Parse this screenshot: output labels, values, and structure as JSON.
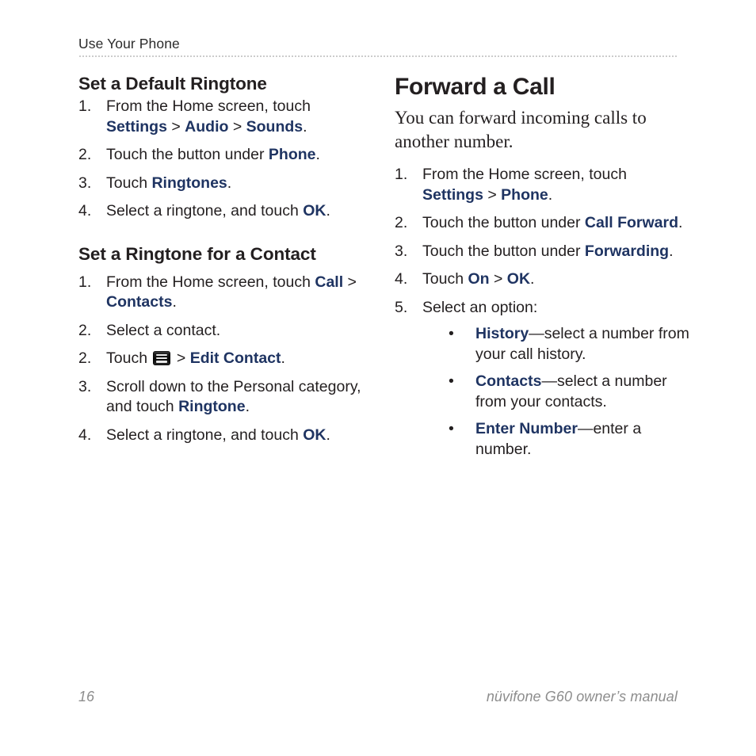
{
  "header": {
    "running_head": "Use Your Phone"
  },
  "left_column": {
    "sections": [
      {
        "heading": "Set a Default Ringtone",
        "steps": [
          {
            "num": "1.",
            "parts": [
              {
                "t": "From the Home screen, touch ",
                "s": "plain"
              },
              {
                "t": "Settings",
                "s": "ui"
              },
              {
                "t": " > ",
                "s": "plain"
              },
              {
                "t": "Audio",
                "s": "ui"
              },
              {
                "t": " > ",
                "s": "plain"
              },
              {
                "t": "Sounds",
                "s": "ui"
              },
              {
                "t": ".",
                "s": "plain"
              }
            ]
          },
          {
            "num": "2.",
            "parts": [
              {
                "t": "Touch the button under ",
                "s": "plain"
              },
              {
                "t": "Phone",
                "s": "ui"
              },
              {
                "t": ".",
                "s": "plain"
              }
            ]
          },
          {
            "num": "3.",
            "parts": [
              {
                "t": "Touch ",
                "s": "plain"
              },
              {
                "t": "Ringtones",
                "s": "ui"
              },
              {
                "t": ".",
                "s": "plain"
              }
            ]
          },
          {
            "num": "4.",
            "parts": [
              {
                "t": "Select a ringtone, and touch ",
                "s": "plain"
              },
              {
                "t": "OK",
                "s": "ui"
              },
              {
                "t": ".",
                "s": "plain"
              }
            ]
          }
        ]
      },
      {
        "heading": "Set a Ringtone for a Contact",
        "steps": [
          {
            "num": "1.",
            "parts": [
              {
                "t": "From the Home screen, touch ",
                "s": "plain"
              },
              {
                "t": "Call",
                "s": "ui"
              },
              {
                "t": " > ",
                "s": "plain"
              },
              {
                "t": "Contacts",
                "s": "ui"
              },
              {
                "t": ".",
                "s": "plain"
              }
            ]
          },
          {
            "num": "2.",
            "parts": [
              {
                "t": "Select a contact.",
                "s": "plain"
              }
            ]
          },
          {
            "num": "2.",
            "parts": [
              {
                "t": "Touch ",
                "s": "plain"
              },
              {
                "t": "menu-icon",
                "s": "icon"
              },
              {
                "t": " > ",
                "s": "plain"
              },
              {
                "t": "Edit Contact",
                "s": "ui"
              },
              {
                "t": ".",
                "s": "plain"
              }
            ]
          },
          {
            "num": "3.",
            "parts": [
              {
                "t": "Scroll down to the Personal category, and touch ",
                "s": "plain"
              },
              {
                "t": "Ringtone",
                "s": "ui"
              },
              {
                "t": ".",
                "s": "plain"
              }
            ]
          },
          {
            "num": "4.",
            "parts": [
              {
                "t": "Select a ringtone, and touch ",
                "s": "plain"
              },
              {
                "t": "OK",
                "s": "ui"
              },
              {
                "t": ".",
                "s": "plain"
              }
            ]
          }
        ]
      }
    ]
  },
  "right_column": {
    "heading": "Forward a Call",
    "intro": "You can forward incoming calls to another number.",
    "steps": [
      {
        "num": "1.",
        "parts": [
          {
            "t": "From the Home screen, touch ",
            "s": "plain"
          },
          {
            "t": "Settings",
            "s": "ui"
          },
          {
            "t": " > ",
            "s": "plain"
          },
          {
            "t": "Phone",
            "s": "ui"
          },
          {
            "t": ".",
            "s": "plain"
          }
        ]
      },
      {
        "num": "2.",
        "parts": [
          {
            "t": "Touch the button under ",
            "s": "plain"
          },
          {
            "t": "Call Forward",
            "s": "ui"
          },
          {
            "t": ".",
            "s": "plain"
          }
        ]
      },
      {
        "num": "3.",
        "parts": [
          {
            "t": "Touch the button under ",
            "s": "plain"
          },
          {
            "t": "Forwarding",
            "s": "ui"
          },
          {
            "t": ".",
            "s": "plain"
          }
        ]
      },
      {
        "num": "4.",
        "parts": [
          {
            "t": "Touch ",
            "s": "plain"
          },
          {
            "t": "On",
            "s": "ui"
          },
          {
            "t": " > ",
            "s": "plain"
          },
          {
            "t": "OK",
            "s": "ui"
          },
          {
            "t": ".",
            "s": "plain"
          }
        ]
      },
      {
        "num": "5.",
        "parts": [
          {
            "t": "Select an option:",
            "s": "plain"
          }
        ],
        "bullets": [
          {
            "marker": "•",
            "parts": [
              {
                "t": "History",
                "s": "ui"
              },
              {
                "t": "—select a number from your call history.",
                "s": "plain"
              }
            ]
          },
          {
            "marker": "•",
            "parts": [
              {
                "t": "Contacts",
                "s": "ui"
              },
              {
                "t": "—select a number from your contacts.",
                "s": "plain"
              }
            ]
          },
          {
            "marker": "•",
            "parts": [
              {
                "t": "Enter Number",
                "s": "ui"
              },
              {
                "t": "—enter a number.",
                "s": "plain"
              }
            ]
          }
        ]
      }
    ]
  },
  "footer": {
    "page_number": "16",
    "manual_title": "nüvifone G60 owner’s manual"
  },
  "colors": {
    "ui_term": "#1f3462",
    "body_text": "#231f20",
    "footer_text": "#8d8d8d",
    "rule": "#9a9a9a",
    "background": "#ffffff"
  }
}
